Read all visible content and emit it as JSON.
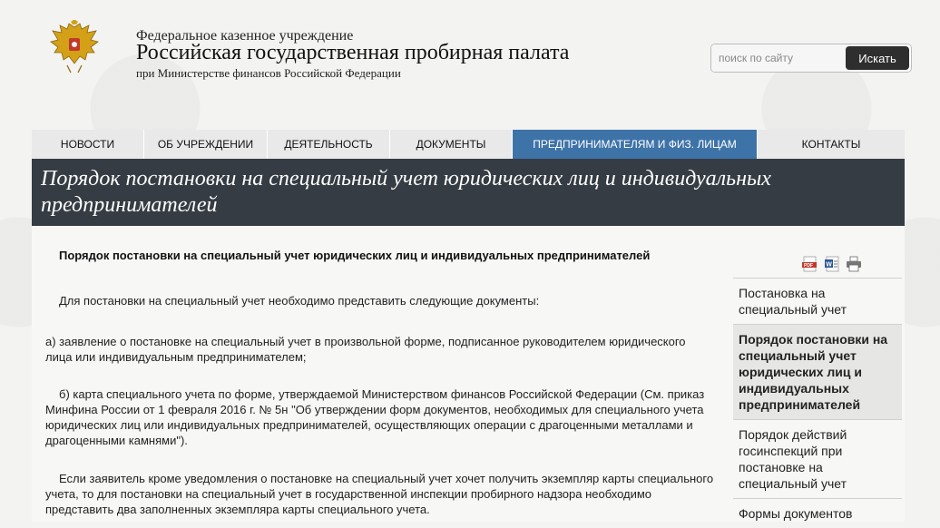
{
  "header": {
    "org_small": "Федеральное казенное учреждение",
    "org_main": "Российская государственная пробирная палата",
    "org_sub": "при Министерстве финансов Российской Федерации",
    "emblem_icon": "coat-of-arms-icon"
  },
  "search": {
    "placeholder": "поиск по сайту",
    "button_label": "Искать"
  },
  "nav": {
    "items": [
      {
        "label": "НОВОСТИ"
      },
      {
        "label": "ОБ УЧРЕЖДЕНИИ"
      },
      {
        "label": "ДЕЯТЕЛЬНОСТЬ"
      },
      {
        "label": "ДОКУМЕНТЫ"
      },
      {
        "label": "ПРЕДПРИНИМАТЕЛЯМ И ФИЗ. ЛИЦАМ"
      },
      {
        "label": "КОНТАКТЫ"
      }
    ],
    "active_index": 4,
    "active_color": "#3e73a8"
  },
  "page": {
    "title": "Порядок постановки на специальный учет юридических лиц и индивидуальных предпринимателей"
  },
  "article": {
    "heading": "Порядок постановки на специальный учет юридических лиц и индивидуальных предпринимателей",
    "paragraphs": [
      "Для постановки на специальный учет необходимо представить следующие документы:",
      "а) заявление о постановке на специальный учет в произвольной форме, подписанное руководителем юридического лица или индивидуальным предпринимателем;",
      "б) карта специального учета по форме, утверждаемой Министерством финансов Российской Федерации (См. приказ Минфина России от 1 февраля 2016 г. № 5н \"Об утверждении форм документов, необходимых для специального учета юридических лиц или индивидуальных предпринимателей, осуществляющих операции с драгоценными металлами и драгоценными камнями\").",
      "Если заявитель кроме уведомления о постановке на специальный учет хочет получить экземпляр карты специального учета, то для постановки на специальный учет в государственной инспекции пробирного надзора необходимо представить два заполненных экземпляра карты специального учета."
    ]
  },
  "tools": {
    "pdf_icon": "pdf-icon",
    "word_icon": "word-icon",
    "print_icon": "print-icon"
  },
  "sidebar": {
    "items": [
      {
        "label": "Постановка на специальный учет"
      },
      {
        "label": "Порядок постановки на специальный учет юридических лиц и индивидуальных предпринимателей"
      },
      {
        "label": "Порядок действий госинспекций при постановке на специальный учет"
      },
      {
        "label": "Формы документов"
      }
    ],
    "active_index": 1
  },
  "colors": {
    "title_band": "#353c43",
    "nav_bg": "#e9e9e9",
    "search_button": "#2e2e2e"
  }
}
